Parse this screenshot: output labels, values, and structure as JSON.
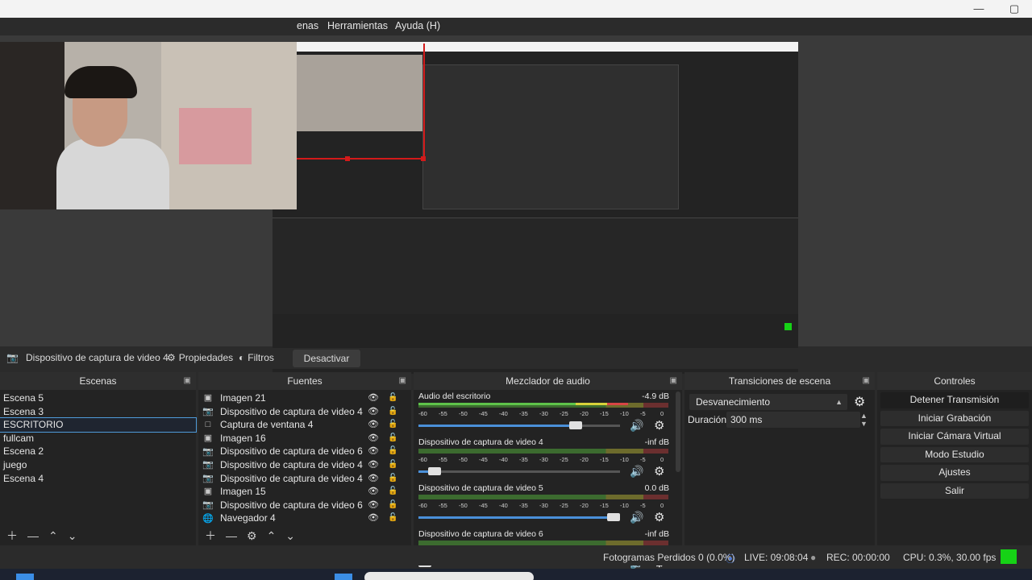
{
  "menu": {
    "escenas_partial": "enas",
    "herramientas": "Herramientas",
    "ayuda": "Ayuda (H)"
  },
  "window": {
    "minimize_icon": "minimize-icon",
    "maximize_icon": "maximize-icon"
  },
  "source_toolbar": {
    "source_name": "Dispositivo de captura de video 4",
    "properties": "Propiedades",
    "filters": "Filtros",
    "deactivate": "Desactivar"
  },
  "scenes": {
    "title": "Escenas",
    "items": [
      "Escena 5",
      "Escena 3",
      "ESCRITORIO",
      "fullcam",
      "Escena 2",
      "juego",
      "Escena 4"
    ],
    "selected_index": 2
  },
  "sources": {
    "title": "Fuentes",
    "items": [
      {
        "label": "Imagen 21",
        "icon": "image-icon"
      },
      {
        "label": "Dispositivo de captura de video 4",
        "icon": "camera-icon"
      },
      {
        "label": "Captura de ventana 4",
        "icon": "window-icon"
      },
      {
        "label": "Imagen 16",
        "icon": "image-icon"
      },
      {
        "label": "Dispositivo de captura de video 6",
        "icon": "camera-icon"
      },
      {
        "label": "Dispositivo de captura de video 4",
        "icon": "camera-icon"
      },
      {
        "label": "Dispositivo de captura de video 4",
        "icon": "camera-icon"
      },
      {
        "label": "Imagen 15",
        "icon": "image-icon"
      },
      {
        "label": "Dispositivo de captura de video 6",
        "icon": "camera-icon"
      },
      {
        "label": "Navegador 4",
        "icon": "globe-icon"
      }
    ]
  },
  "mixer": {
    "title": "Mezclador de audio",
    "tick_labels": [
      "-60",
      "-55",
      "-50",
      "-45",
      "-40",
      "-35",
      "-30",
      "-25",
      "-20",
      "-15",
      "-10",
      "-5",
      "0"
    ],
    "channels": [
      {
        "name": "Audio del escritorio",
        "db": "-4.9 dB",
        "level": 0.84,
        "volume": 0.8
      },
      {
        "name": "Dispositivo de captura de video 4",
        "db": "-inf dB",
        "level": 0.0,
        "volume": 0.05
      },
      {
        "name": "Dispositivo de captura de video 5",
        "db": "0.0 dB",
        "level": 0.0,
        "volume": 1.0
      },
      {
        "name": "Dispositivo de captura de video 6",
        "db": "-inf dB",
        "level": 0.0,
        "volume": 0.0
      }
    ]
  },
  "transitions": {
    "title": "Transiciones de escena",
    "selected": "Desvanecimiento",
    "duration_label": "Duración",
    "duration_value": "300 ms"
  },
  "controls": {
    "title": "Controles",
    "buttons": [
      "Detener Transmisión",
      "Iniciar Grabación",
      "Iniciar Cámara Virtual",
      "Modo Estudio",
      "Ajustes",
      "Salir"
    ]
  },
  "status": {
    "dropped": "Fotogramas Perdidos 0 (0.0%)",
    "live": "LIVE: 09:08:04",
    "rec": "REC: 00:00:00",
    "cpu": "CPU: 0.3%, 30.00 fps",
    "health_color": "#16d216"
  },
  "colors": {
    "accent": "#4f9bd9",
    "live_red": "#d31a1a"
  }
}
